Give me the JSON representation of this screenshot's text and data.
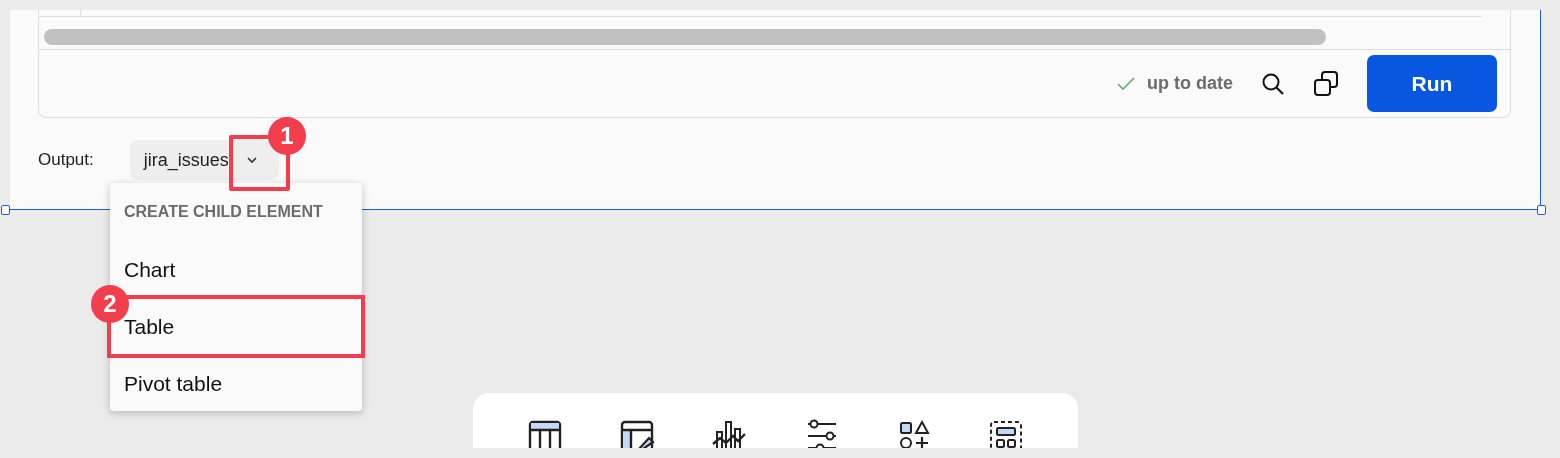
{
  "status": {
    "text": "up to date",
    "ok": true
  },
  "run_button": {
    "label": "Run"
  },
  "output": {
    "label": "Output:",
    "value": "jira_issues"
  },
  "menu": {
    "header": "CREATE CHILD ELEMENT",
    "items": [
      {
        "label": "Chart",
        "selected": false
      },
      {
        "label": "Table",
        "selected": false
      },
      {
        "label": "Pivot table",
        "selected": false
      }
    ]
  },
  "annotations": [
    {
      "label": "1"
    },
    {
      "label": "2"
    }
  ]
}
